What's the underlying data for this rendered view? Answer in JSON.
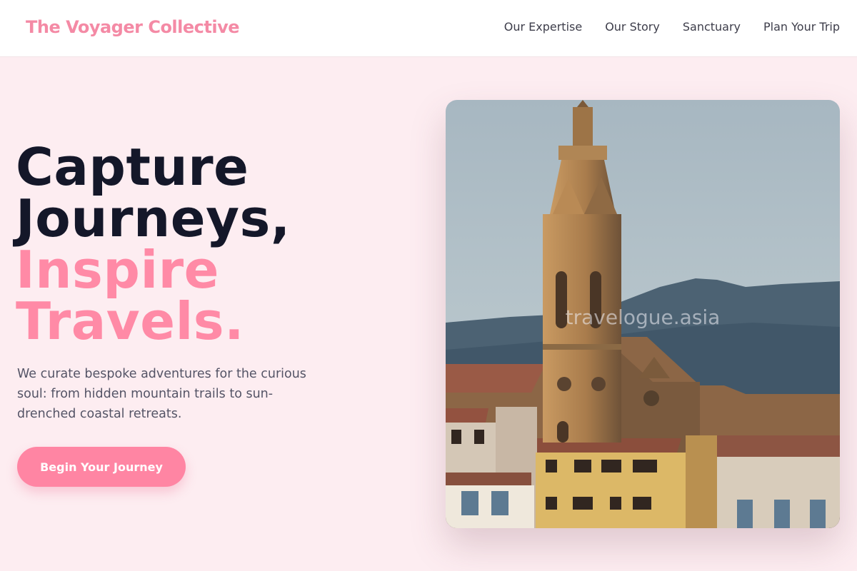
{
  "header": {
    "brand": "The Voyager Collective",
    "nav": [
      "Our Expertise",
      "Our Story",
      "Sanctuary",
      "Plan Your Trip"
    ]
  },
  "hero": {
    "headline_line1": "Capture",
    "headline_line2": "Journeys,",
    "headline_line3": "Inspire",
    "headline_line4": "Travels.",
    "description": "We curate bespoke adventures for the curious soul: from hidden mountain trails to sun-drenched coastal retreats.",
    "cta_label": "Begin Your Journey",
    "image_watermark": "travelogue.asia"
  },
  "colors": {
    "brand_pink": "#f48aa5",
    "accent_pink": "#ff85a3",
    "headline_dark": "#141729",
    "hero_background": "#fdedf1"
  }
}
